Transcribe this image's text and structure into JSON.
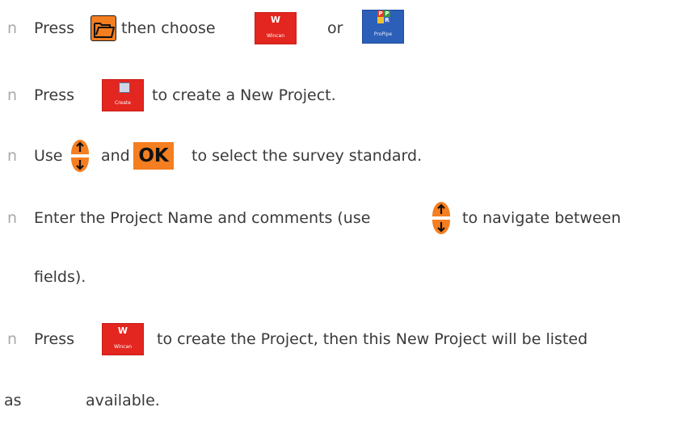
{
  "bullet": "n",
  "steps": [
    {
      "press": "Press",
      "then_choose": "then choose",
      "or": "or"
    },
    {
      "press": "Press",
      "rest": "to create a New Project."
    },
    {
      "use": "Use",
      "and": "and",
      "rest": "to select the survey standard."
    },
    {
      "start": "Enter the Project Name and comments (use",
      "end": "to navigate between",
      "cont": "fields)."
    },
    {
      "press": "Press",
      "rest": "to create the Project, then this New Project will be listed",
      "cont_a": "as",
      "cont_b": "available."
    }
  ],
  "icons": {
    "wincan": {
      "mark": "W",
      "label": "Wincan"
    },
    "propipe": {
      "label": "ProPipe",
      "letters": [
        "P",
        "P",
        "",
        "R"
      ]
    },
    "create": {
      "label": "Create"
    },
    "ok": {
      "label": "OK"
    }
  },
  "colors": {
    "orange": "#f47e20",
    "red": "#e3261f",
    "blue": "#2b5fb8",
    "text": "#3a3a3a",
    "bullet": "#a9a9a9"
  }
}
